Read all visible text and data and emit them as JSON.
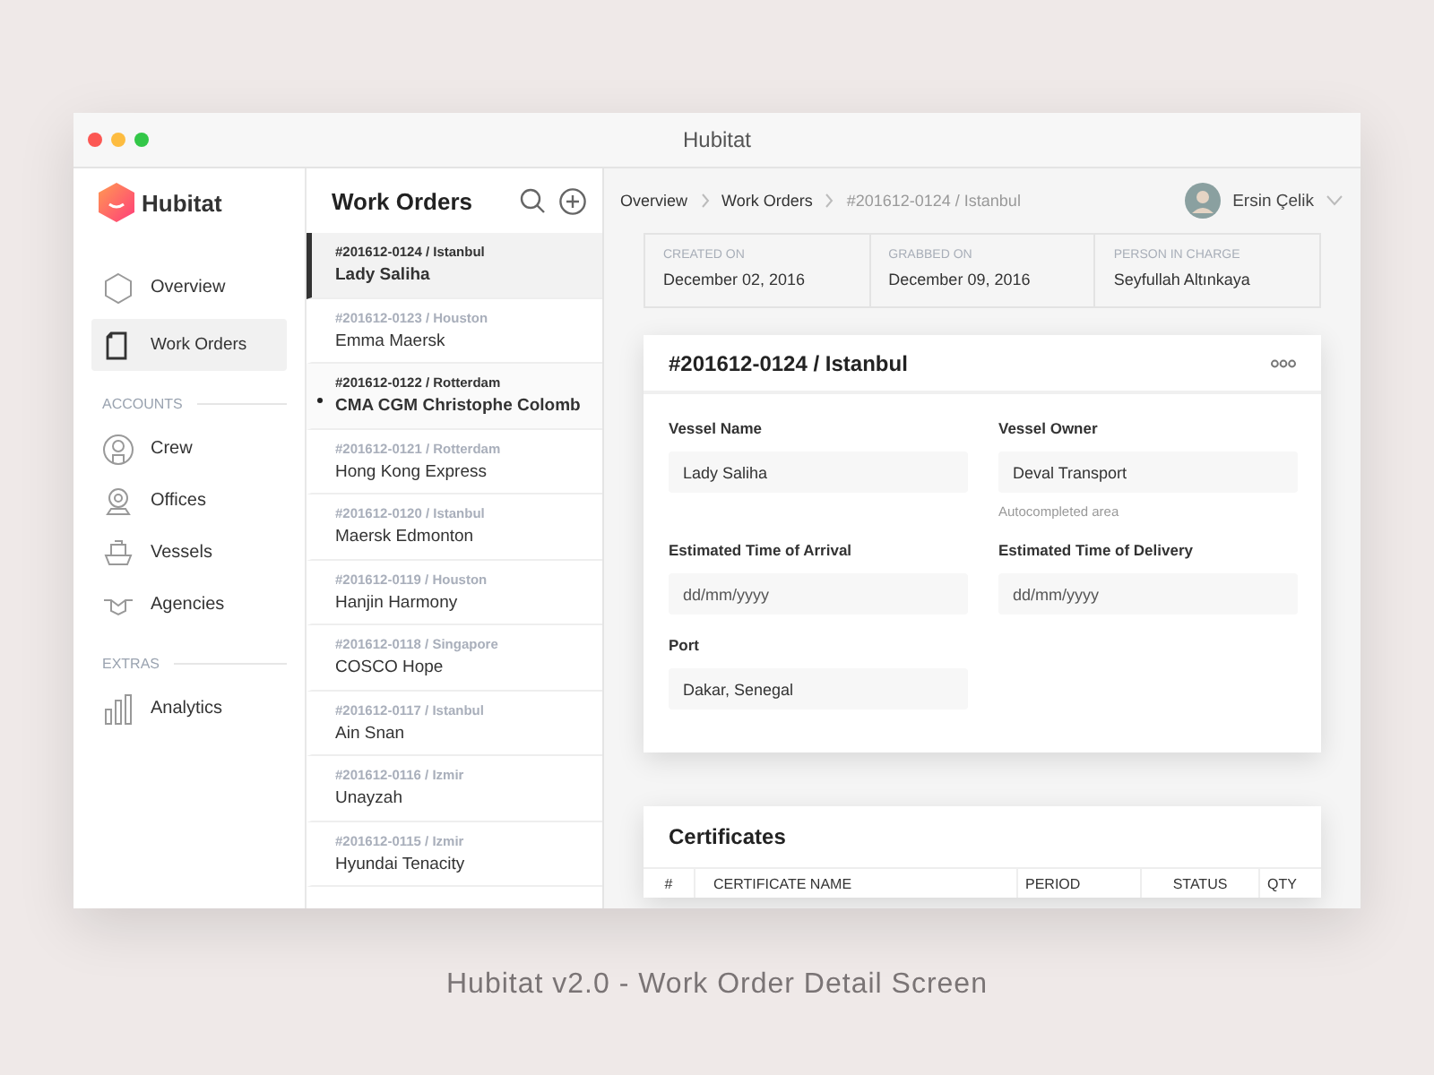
{
  "window": {
    "title": "Hubitat"
  },
  "sidebar": {
    "logo": "Hubitat",
    "sections": [
      {
        "items": [
          {
            "label": "Overview",
            "selected": false
          },
          {
            "label": "Work Orders",
            "selected": true
          }
        ]
      },
      {
        "heading": "ACCOUNTS",
        "items": [
          {
            "label": "Crew",
            "selected": false
          },
          {
            "label": "Offices",
            "selected": false
          },
          {
            "label": "Vessels",
            "selected": false
          },
          {
            "label": "Agencies",
            "selected": false
          }
        ]
      },
      {
        "heading": "EXTRAS",
        "items": [
          {
            "label": "Analytics",
            "selected": false
          }
        ]
      }
    ]
  },
  "orders": {
    "title": "Work Orders",
    "items": [
      {
        "code": "#201612-0124 / Istanbul",
        "name": "Lady Saliha",
        "selected": true,
        "unread": false
      },
      {
        "code": "#201612-0123 / Houston",
        "name": "Emma Maersk",
        "selected": false,
        "unread": false
      },
      {
        "code": "#201612-0122 / Rotterdam",
        "name": "CMA CGM Christophe Colomb",
        "selected": false,
        "unread": true
      },
      {
        "code": "#201612-0121 / Rotterdam",
        "name": "Hong Kong Express",
        "selected": false,
        "unread": false
      },
      {
        "code": "#201612-0120 / Istanbul",
        "name": "Maersk Edmonton",
        "selected": false,
        "unread": false
      },
      {
        "code": "#201612-0119 / Houston",
        "name": "Hanjin Harmony",
        "selected": false,
        "unread": false
      },
      {
        "code": "#201612-0118 / Singapore",
        "name": "COSCO Hope",
        "selected": false,
        "unread": false
      },
      {
        "code": "#201612-0117 / Istanbul",
        "name": "Ain Snan",
        "selected": false,
        "unread": false
      },
      {
        "code": "#201612-0116 / Izmir",
        "name": "Unayzah",
        "selected": false,
        "unread": false
      },
      {
        "code": "#201612-0115 / Izmir",
        "name": "Hyundai Tenacity",
        "selected": false,
        "unread": false
      }
    ]
  },
  "breadcrumb": [
    "Overview",
    "Work Orders",
    "#201612-0124 / Istanbul"
  ],
  "user": {
    "name": "Ersin Çelik"
  },
  "info": [
    {
      "label": "CREATED ON",
      "value": "December 02, 2016"
    },
    {
      "label": "GRABBED ON",
      "value": "December 09, 2016"
    },
    {
      "label": "PERSON IN CHARGE",
      "value": "Seyfullah Altınkaya"
    }
  ],
  "detail": {
    "title": "#201612-0124 / Istanbul",
    "fields": [
      {
        "label": "Vessel Name",
        "value": "Lady Saliha"
      },
      {
        "label": "Vessel Owner",
        "value": "Deval Transport",
        "hint": "Autocompleted area"
      },
      {
        "label": "Estimated Time of Arrival",
        "placeholder": "dd/mm/yyyy"
      },
      {
        "label": "Estimated Time of Delivery",
        "placeholder": "dd/mm/yyyy"
      },
      {
        "label": "Port",
        "value": "Dakar, Senegal"
      }
    ]
  },
  "certificates": {
    "title": "Certificates",
    "columns": [
      "#",
      "CERTIFICATE NAME",
      "PERIOD",
      "STATUS",
      "QTY"
    ]
  },
  "caption": "Hubitat v2.0 - Work Order Detail Screen"
}
